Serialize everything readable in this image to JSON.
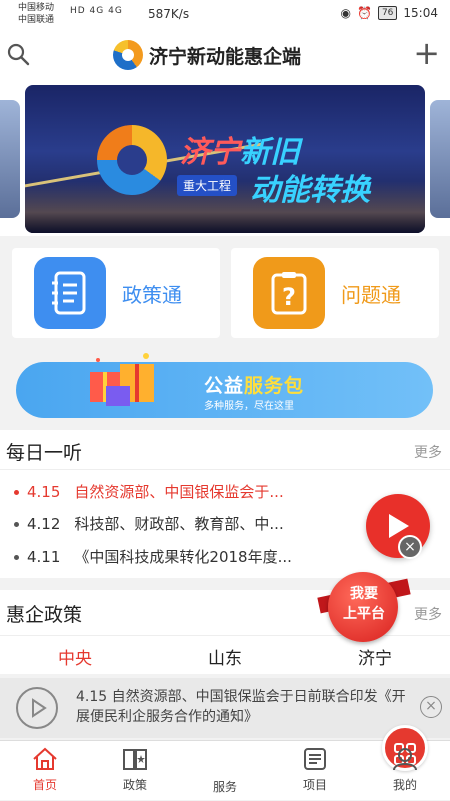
{
  "status_bar": {
    "carrier1": "中国移动",
    "carrier2": "中国联通",
    "signal": "HD 4G 4G",
    "net_speed": "587K/s",
    "battery": "76",
    "time": "15:04"
  },
  "header": {
    "title": "济宁新动能惠企端"
  },
  "banner": {
    "line1_red": "济宁",
    "line1_blue": "新旧",
    "line2": "动能转换",
    "tag": "重大工程"
  },
  "entries": [
    {
      "label": "政策通",
      "color": "#3e8ef0",
      "icon": "notebook-icon"
    },
    {
      "label": "问题通",
      "color": "#f09a1a",
      "icon": "question-clipboard-icon"
    }
  ],
  "promo": {
    "title_white": "公益",
    "title_yellow": "服务包",
    "subtitle": "多种服务，尽在这里"
  },
  "daily": {
    "title": "每日一听",
    "more": "更多",
    "items": [
      {
        "date": "4.15",
        "text": "自然资源部、中国银保监会于..."
      },
      {
        "date": "4.12",
        "text": "科技部、财政部、教育部、中..."
      },
      {
        "date": "4.11",
        "text": "《中国科技成果转化2018年度..."
      }
    ]
  },
  "policy": {
    "title": "惠企政策",
    "more": "更多",
    "tabs": [
      "中央",
      "山东",
      "济宁"
    ]
  },
  "platform_badge": {
    "line1": "我要",
    "line2": "上平台"
  },
  "player": {
    "text": "4.15 自然资源部、中国银保监会于日前联合印发《开展便民利企服务合作的通知》"
  },
  "tabbar": [
    {
      "label": "首页",
      "active": true
    },
    {
      "label": "政策",
      "active": false
    },
    {
      "label": "服务",
      "active": false
    },
    {
      "label": "项目",
      "active": false
    },
    {
      "label": "我的",
      "active": false
    }
  ],
  "colors": {
    "accent": "#e5392f",
    "blue": "#3e8ef0",
    "orange": "#f09a1a"
  }
}
